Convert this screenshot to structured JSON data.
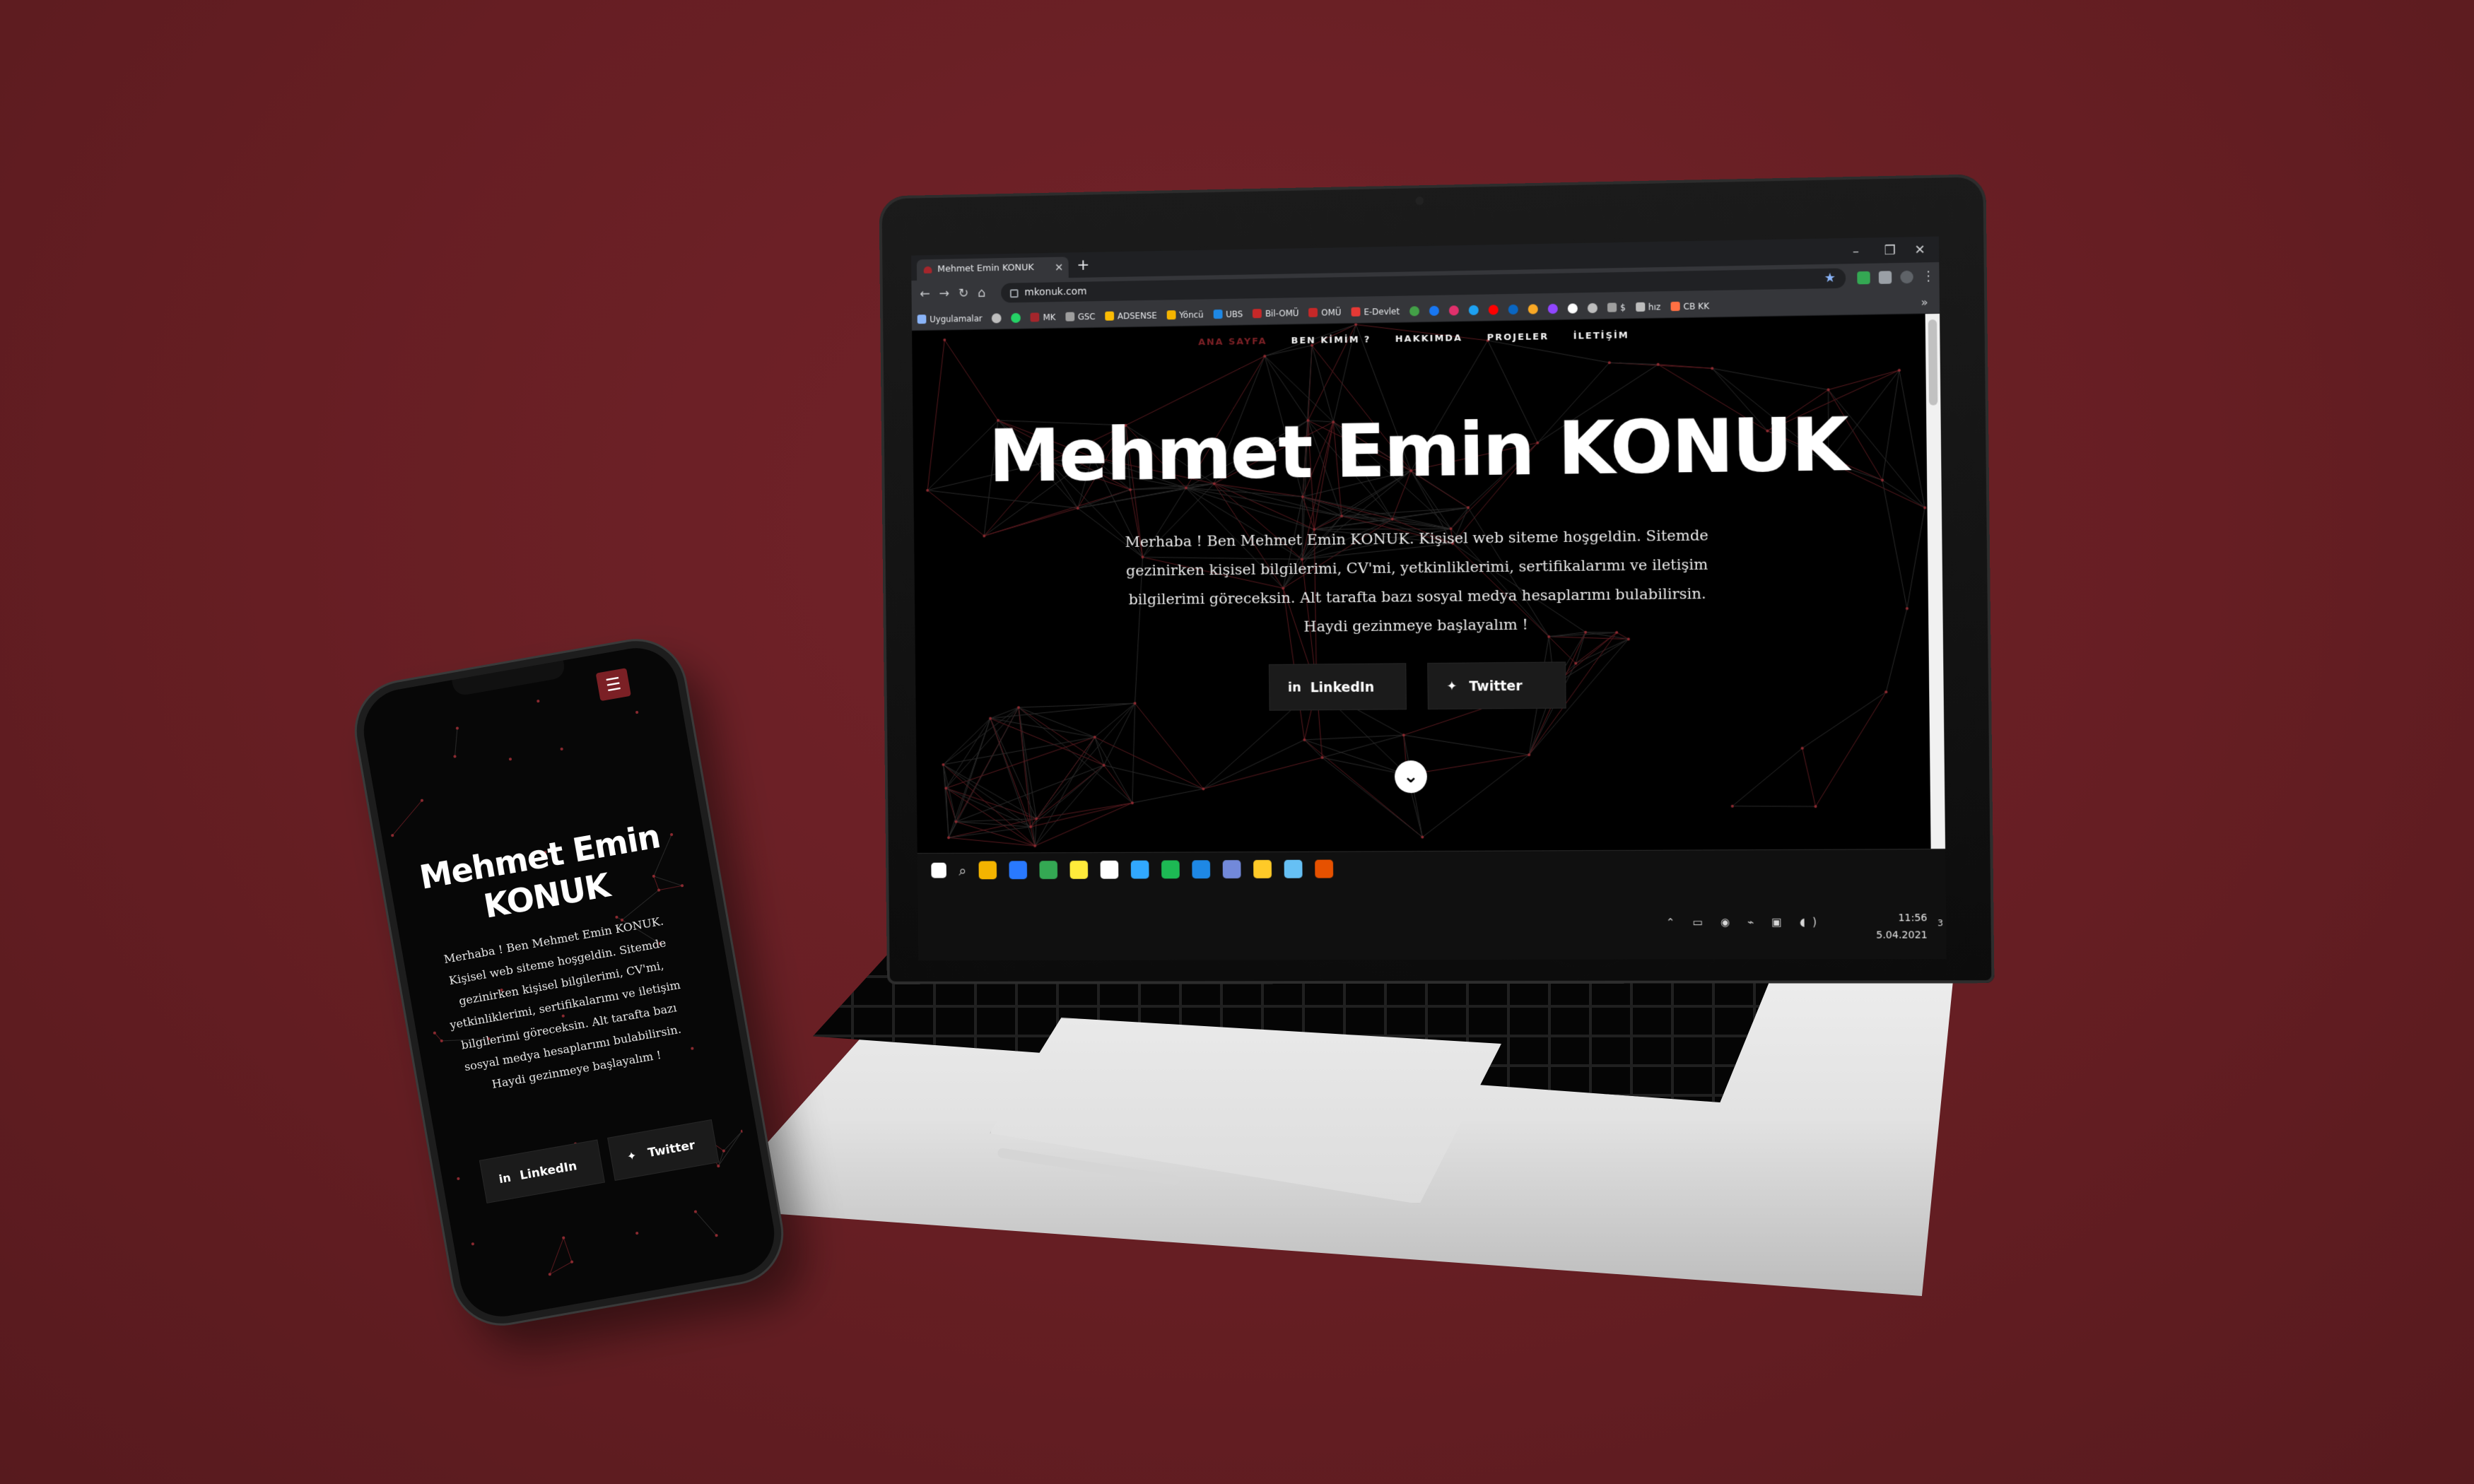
{
  "browser": {
    "tab_title": "Mehmet Emin KONUK",
    "url": "mkonuk.com",
    "bookmarks": [
      {
        "label": "Uygulamalar",
        "color": "#8ab4f8"
      },
      {
        "label": "",
        "color": "#bdbdbd"
      },
      {
        "label": "",
        "color": "#25d366"
      },
      {
        "label": "MK",
        "color": "#a4262c"
      },
      {
        "label": "GSC",
        "color": "#9e9e9e"
      },
      {
        "label": "ADSENSE",
        "color": "#fbbc04"
      },
      {
        "label": "Yöncü",
        "color": "#f4b400"
      },
      {
        "label": "UBS",
        "color": "#1e88e5"
      },
      {
        "label": "Bil-OMÜ",
        "color": "#c62828"
      },
      {
        "label": "OMÜ",
        "color": "#c62828"
      },
      {
        "label": "E-Devlet",
        "color": "#e53935"
      },
      {
        "label": "",
        "color": "#43a047"
      },
      {
        "label": "",
        "color": "#1877f2"
      },
      {
        "label": "",
        "color": "#e1306c"
      },
      {
        "label": "",
        "color": "#1da1f2"
      },
      {
        "label": "",
        "color": "#ff0000"
      },
      {
        "label": "",
        "color": "#0a66c2"
      },
      {
        "label": "",
        "color": "#f9a825"
      },
      {
        "label": "",
        "color": "#9146ff"
      },
      {
        "label": "",
        "color": "#ffffff"
      },
      {
        "label": "",
        "color": "#bdbdbd"
      },
      {
        "label": "$",
        "color": "#9e9e9e"
      },
      {
        "label": "hız",
        "color": "#bdbdbd"
      },
      {
        "label": "CB KK",
        "color": "#ff7043"
      }
    ]
  },
  "site": {
    "nav": [
      "ANA SAYFA",
      "BEN KİMİM ?",
      "HAKKIMDA",
      "PROJELER",
      "İLETİŞİM"
    ],
    "title": "Mehmet Emin KONUK",
    "intro": "Merhaba ! Ben Mehmet Emin KONUK. Kişisel web siteme hoşgeldin. Sitemde gezinirken kişisel bilgilerimi, CV'mi, yetkinliklerimi, sertifikalarımı ve iletişim bilgilerimi göreceksin. Alt tarafta bazı sosyal medya hesaplarımı bulabilirsin. Haydi gezinmeye başlayalım !",
    "buttons": {
      "linkedin": "LinkedIn",
      "twitter": "Twitter"
    }
  },
  "phone": {
    "title_line1": "Mehmet Emin",
    "title_line2": "KONUK",
    "intro": "Merhaba ! Ben Mehmet Emin KONUK. Kişisel web siteme hoşgeldin. Sitemde gezinirken kişisel bilgilerimi, CV'mi, yetkinliklerimi, sertifikalarımı ve iletişim bilgilerimi göreceksin. Alt tarafta bazı sosyal medya hesaplarımı bulabilirsin. Haydi gezinmeye başlayalım !"
  },
  "taskbar": {
    "time": "11:56",
    "date": "5.04.2021",
    "notifications": "3",
    "apps": [
      "#f4b400",
      "#2979ff",
      "#34a853",
      "#ffeb3b",
      "#ffffff",
      "#31a8ff",
      "#1db954",
      "#1e88e5",
      "#7289da",
      "#ffca28",
      "#66c0f4",
      "#e65100"
    ]
  },
  "colors": {
    "accent": "#7b2025",
    "background": "#661e23"
  }
}
